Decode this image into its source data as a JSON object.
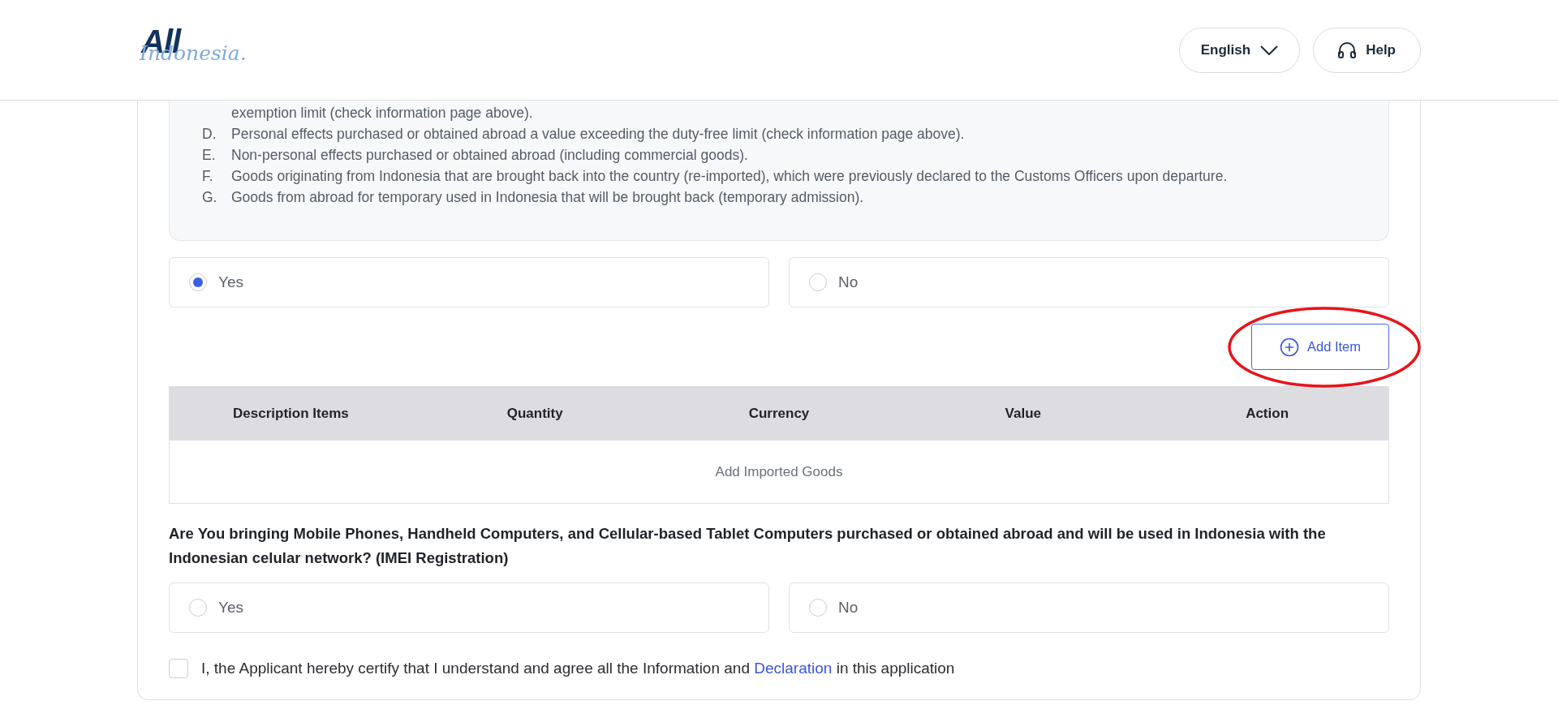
{
  "header": {
    "logo": {
      "main": "All",
      "script": "Indonesia."
    },
    "language": "English",
    "help": "Help"
  },
  "info_list": [
    {
      "text": "exemption limit (check information page above)."
    },
    {
      "marker": "D.",
      "text": "Personal effects purchased or obtained abroad a value exceeding the duty-free limit (check information page above)."
    },
    {
      "marker": "E.",
      "text": "Non-personal effects purchased or obtained abroad (including commercial goods)."
    },
    {
      "marker": "F.",
      "text": "Goods originating from Indonesia that are brought back into the country (re-imported), which were previously declared to the Customs Officers upon departure."
    },
    {
      "marker": "G.",
      "text": "Goods from abroad for temporary used in Indonesia that will be brought back (temporary admission)."
    }
  ],
  "goods_question": {
    "options": [
      {
        "label": "Yes",
        "selected": true
      },
      {
        "label": "No",
        "selected": false
      }
    ]
  },
  "add_item": "Add Item",
  "table": {
    "columns": [
      "Description Items",
      "Quantity",
      "Currency",
      "Value",
      "Action"
    ],
    "empty_text": "Add Imported Goods"
  },
  "imei_question": {
    "text": "Are You bringing Mobile Phones, Handheld Computers, and Cellular-based Tablet Computers purchased or obtained abroad and will be used in Indonesia with the Indonesian celular network? (IMEI Registration)",
    "options": [
      {
        "label": "Yes",
        "selected": false
      },
      {
        "label": "No",
        "selected": false
      }
    ]
  },
  "agreement": {
    "checked": false,
    "before": "I, the Applicant hereby certify that I understand and agree all the Information and",
    "link": "Declaration",
    "after": "in this application"
  }
}
